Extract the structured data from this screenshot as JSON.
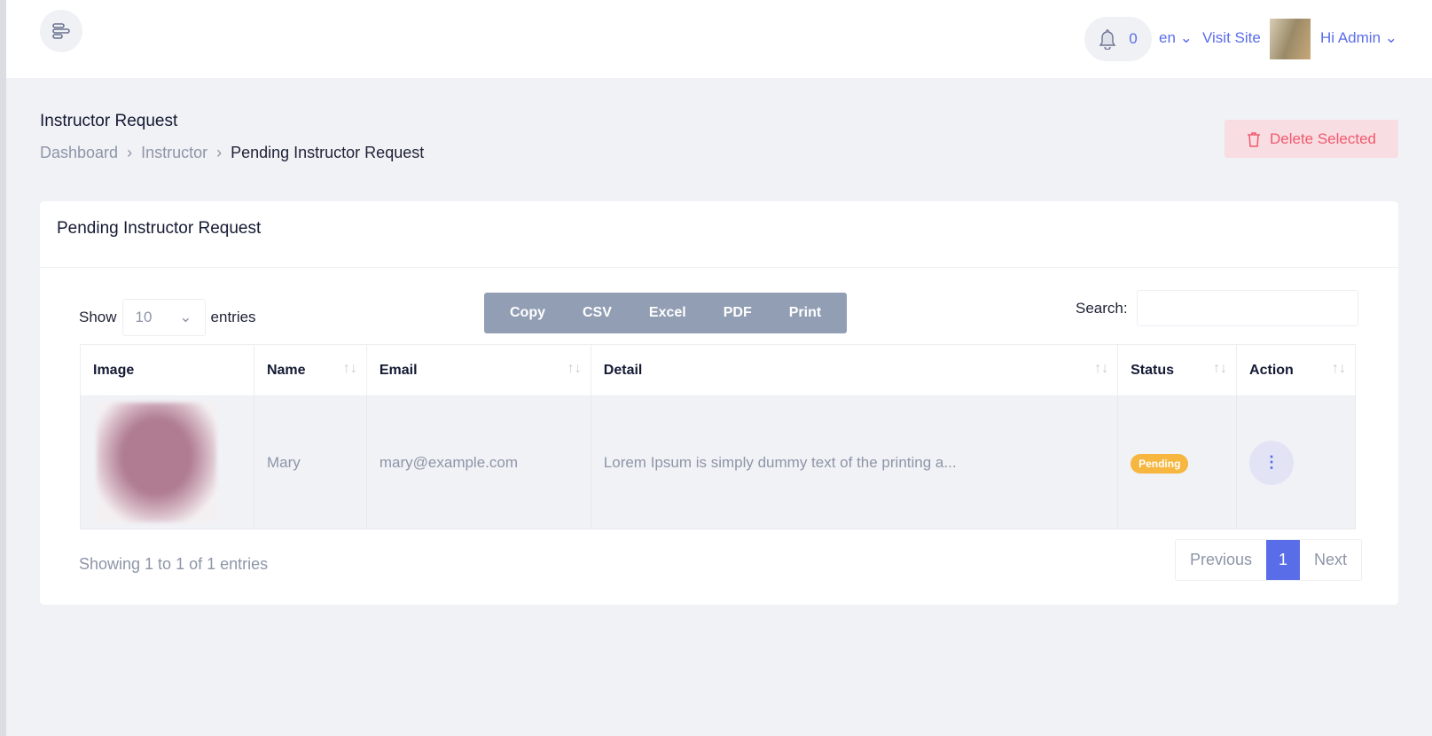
{
  "header": {
    "notification_count": "0",
    "language": "en",
    "visit_site": "Visit Site",
    "user_greeting": "Hi Admin"
  },
  "page": {
    "title": "Instructor Request",
    "breadcrumb": [
      "Dashboard",
      "Instructor",
      "Pending Instructor Request"
    ],
    "delete_selected": "Delete Selected"
  },
  "card": {
    "title": "Pending Instructor Request",
    "show_label": "Show",
    "entries_value": "10",
    "entries_label": "entries",
    "export_buttons": [
      "Copy",
      "CSV",
      "Excel",
      "PDF",
      "Print"
    ],
    "search_label": "Search:",
    "search_value": "",
    "columns": [
      "Image",
      "Name",
      "Email",
      "Detail",
      "Status",
      "Action"
    ],
    "rows": [
      {
        "name": "Mary",
        "email": "mary@example.com",
        "detail": "Lorem Ipsum is simply dummy text of the printing a...",
        "status": "Pending"
      }
    ],
    "info": "Showing 1 to 1 of 1 entries",
    "pagination": {
      "previous": "Previous",
      "current": "1",
      "next": "Next"
    }
  },
  "colors": {
    "accent": "#5a6de8",
    "pending": "#f6b63f",
    "danger": "#f05a6e"
  }
}
